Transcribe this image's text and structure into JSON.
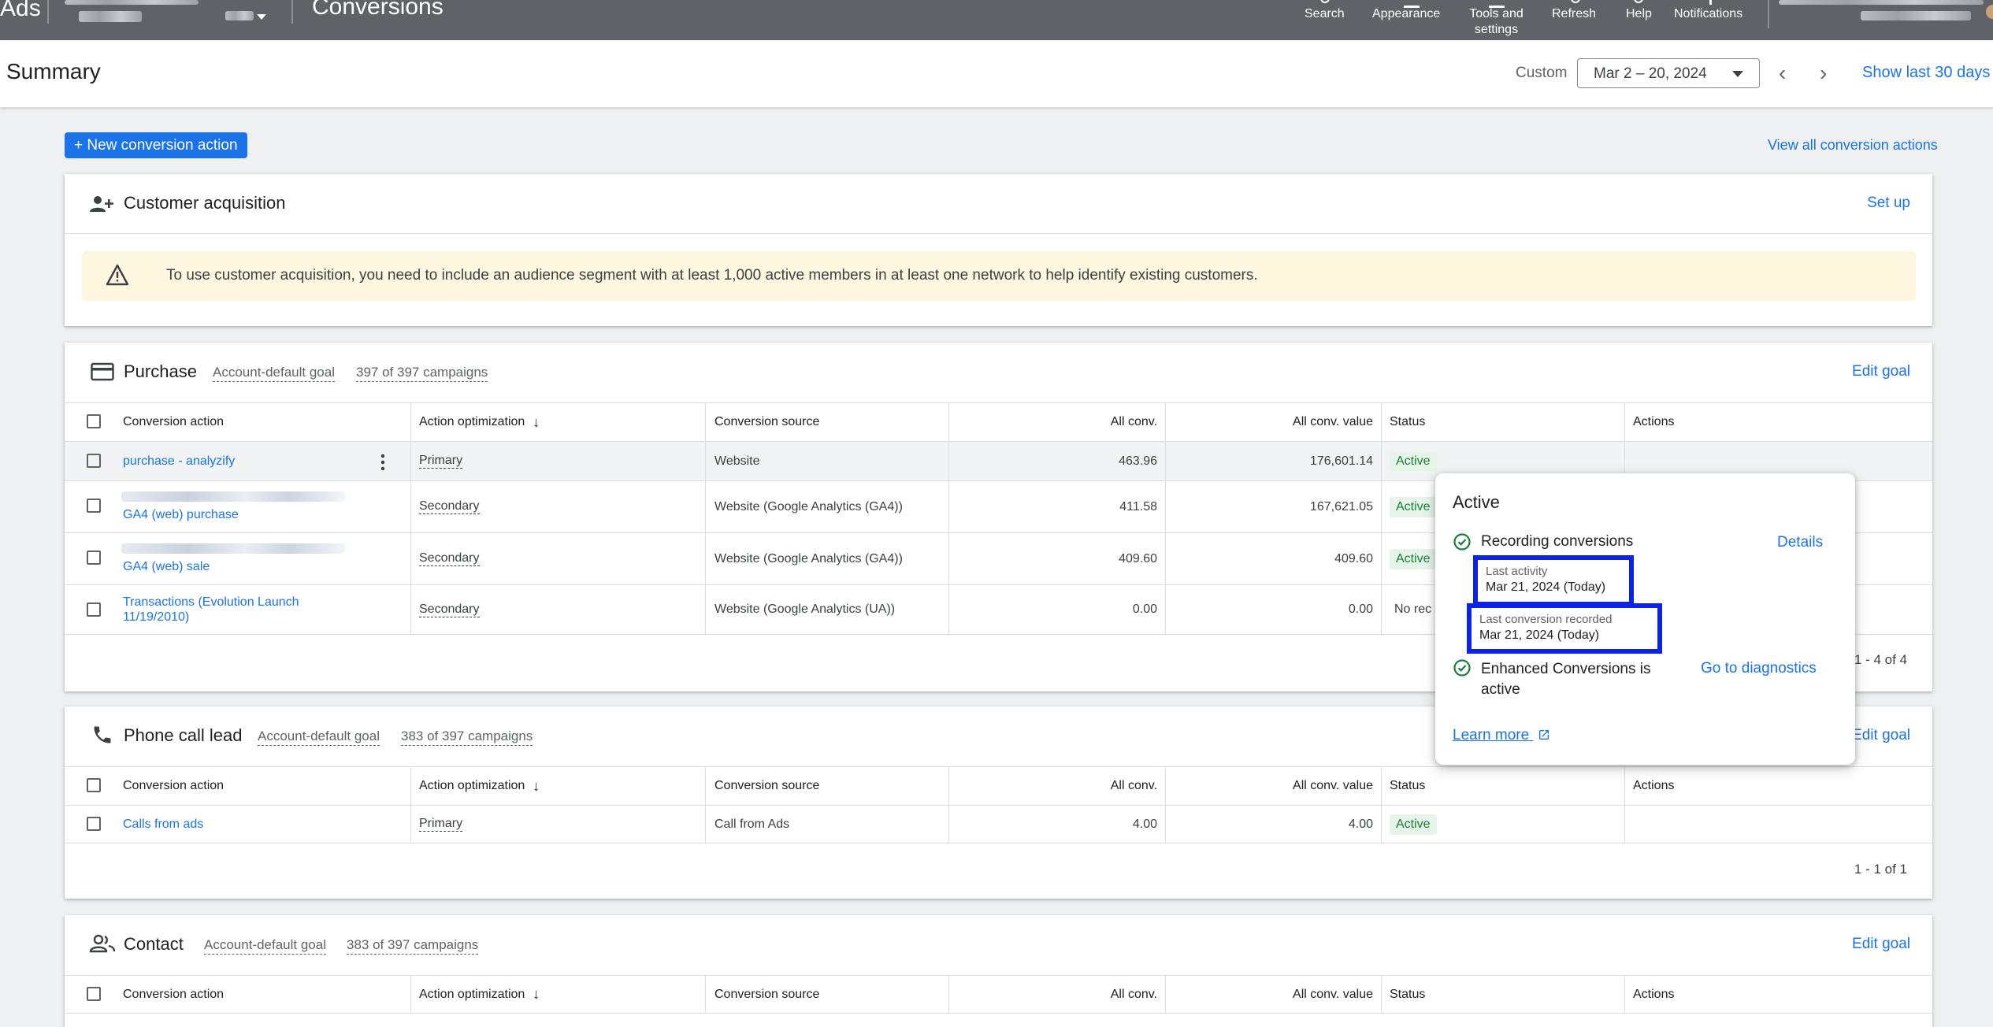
{
  "topbar": {
    "brand": "Ads",
    "page_name": "Conversions",
    "tools": [
      {
        "label": "Search"
      },
      {
        "label": "Appearance"
      },
      {
        "label": "Tools and settings"
      },
      {
        "label": "Refresh"
      },
      {
        "label": "Help"
      },
      {
        "label": "Notifications"
      }
    ]
  },
  "header": {
    "title": "Summary",
    "custom_label": "Custom",
    "date_range": "Mar 2 – 20, 2024",
    "show_last": "Show last 30 days"
  },
  "new_action_button": "+ New conversion action",
  "view_all_link": "View all conversion actions",
  "customer_acquisition": {
    "title": "Customer acquisition",
    "action": "Set up",
    "warning": "To use customer acquisition, you need to include an audience segment with at least 1,000 active members in at least one network to help identify existing customers."
  },
  "columns": {
    "conversion_action": "Conversion action",
    "action_optimization": "Action optimization",
    "conversion_source": "Conversion source",
    "all_conv": "All conv.",
    "all_conv_value": "All conv. value",
    "status": "Status",
    "actions": "Actions"
  },
  "purchase": {
    "title": "Purchase",
    "goal": "Account-default goal",
    "campaigns": "397 of 397 campaigns",
    "edit": "Edit goal",
    "rows": [
      {
        "name": "purchase - analyzify",
        "opt": "Primary",
        "source": "Website",
        "conv": "463.96",
        "value": "176,601.14",
        "status": "Active"
      },
      {
        "name": "GA4 (web) purchase",
        "opt": "Secondary",
        "source": "Website (Google Analytics (GA4))",
        "conv": "411.58",
        "value": "167,621.05",
        "status": "Active"
      },
      {
        "name": "GA4 (web) sale",
        "opt": "Secondary",
        "source": "Website (Google Analytics (GA4))",
        "conv": "409.60",
        "value": "409.60",
        "status": "Active"
      },
      {
        "name": "Transactions (Evolution Launch 11/19/2010)",
        "opt": "Secondary",
        "source": "Website (Google Analytics (UA))",
        "conv": "0.00",
        "value": "0.00",
        "status": "No rec"
      }
    ],
    "pager": "1 - 4 of 4"
  },
  "phone": {
    "title": "Phone call lead",
    "goal": "Account-default goal",
    "campaigns": "383 of 397 campaigns",
    "edit": "Edit goal",
    "rows": [
      {
        "name": "Calls from ads",
        "opt": "Primary",
        "source": "Call from Ads",
        "conv": "4.00",
        "value": "4.00",
        "status": "Active"
      }
    ],
    "pager": "1 - 1 of 1"
  },
  "contact": {
    "title": "Contact",
    "goal": "Account-default goal",
    "campaigns": "383 of 397 campaigns",
    "edit": "Edit goal"
  },
  "popup": {
    "title": "Active",
    "recording": "Recording conversions",
    "details": "Details",
    "last_activity_label": "Last activity",
    "last_activity_value": "Mar 21, 2024 (Today)",
    "last_recorded_label": "Last conversion recorded",
    "last_recorded_value": "Mar 21, 2024 (Today)",
    "enhanced_line1": "Enhanced Conversions is",
    "enhanced_line2": "active",
    "diagnostics": "Go to diagnostics",
    "learn_more": "Learn more"
  },
  "colors": {
    "topbar": "#5f6368",
    "accent": "#1a73e8",
    "active_badge_bg": "#e6f4ea",
    "active_badge_text": "#188038",
    "highlight": "#0b23e6"
  }
}
